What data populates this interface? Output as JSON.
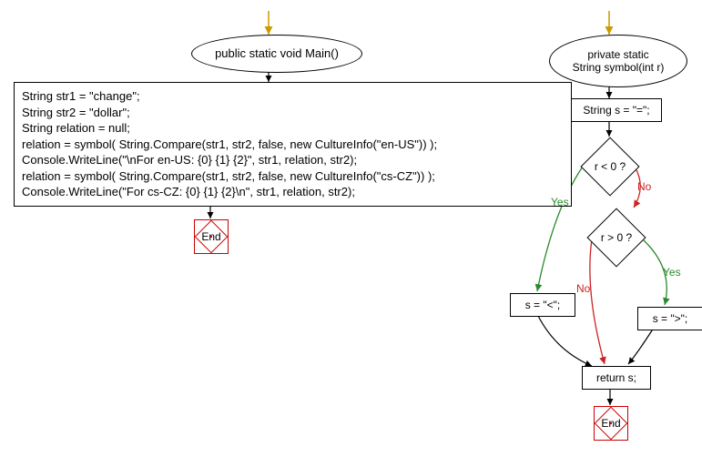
{
  "left": {
    "oval": "public static void Main()",
    "code_lines": [
      "String str1 = \"change\";",
      "String str2 = \"dollar\";",
      "String relation = null;",
      "relation = symbol( String.Compare(str1, str2, false, new CultureInfo(\"en-US\")) );",
      "Console.WriteLine(\"\\nFor en-US: {0} {1} {2}\", str1, relation, str2);",
      "relation = symbol( String.Compare(str1, str2, false, new CultureInfo(\"cs-CZ\")) );",
      "Console.WriteLine(\"For cs-CZ: {0} {1} {2}\\n\", str1, relation, str2);"
    ],
    "end": "End"
  },
  "right": {
    "oval_line1": "private static",
    "oval_line2": "String symbol(int r)",
    "init": "String s = \"=\";",
    "cond1": "r < 0 ?",
    "cond2": "r > 0 ?",
    "assign_lt": "s = \"<\";",
    "assign_gt": "s = \">\";",
    "return": "return s;",
    "end": "End",
    "yes": "Yes",
    "no": "No"
  },
  "chart_data": {
    "type": "flowchart",
    "functions": [
      {
        "name": "Main",
        "signature": "public static void Main()",
        "body": [
          "String str1 = \"change\";",
          "String str2 = \"dollar\";",
          "String relation = null;",
          "relation = symbol( String.Compare(str1, str2, false, new CultureInfo(\"en-US\")) );",
          "Console.WriteLine(\"\\nFor en-US: {0} {1} {2}\", str1, relation, str2);",
          "relation = symbol( String.Compare(str1, str2, false, new CultureInfo(\"cs-CZ\")) );",
          "Console.WriteLine(\"For cs-CZ: {0} {1} {2}\\n\", str1, relation, str2);"
        ],
        "terminal": "End"
      },
      {
        "name": "symbol",
        "signature": "private static String symbol(int r)",
        "nodes": [
          {
            "id": "n1",
            "type": "process",
            "text": "String s = \"=\";"
          },
          {
            "id": "n2",
            "type": "decision",
            "text": "r < 0 ?"
          },
          {
            "id": "n3",
            "type": "decision",
            "text": "r > 0 ?"
          },
          {
            "id": "n4",
            "type": "process",
            "text": "s = \"<\";"
          },
          {
            "id": "n5",
            "type": "process",
            "text": "s = \">\";"
          },
          {
            "id": "n6",
            "type": "process",
            "text": "return s;"
          },
          {
            "id": "n7",
            "type": "terminal",
            "text": "End"
          }
        ],
        "edges": [
          {
            "from": "start",
            "to": "n1"
          },
          {
            "from": "n1",
            "to": "n2"
          },
          {
            "from": "n2",
            "to": "n4",
            "label": "Yes"
          },
          {
            "from": "n2",
            "to": "n3",
            "label": "No"
          },
          {
            "from": "n3",
            "to": "n5",
            "label": "Yes"
          },
          {
            "from": "n3",
            "to": "n6",
            "label": "No"
          },
          {
            "from": "n4",
            "to": "n6"
          },
          {
            "from": "n5",
            "to": "n6"
          },
          {
            "from": "n6",
            "to": "n7"
          }
        ]
      }
    ]
  }
}
